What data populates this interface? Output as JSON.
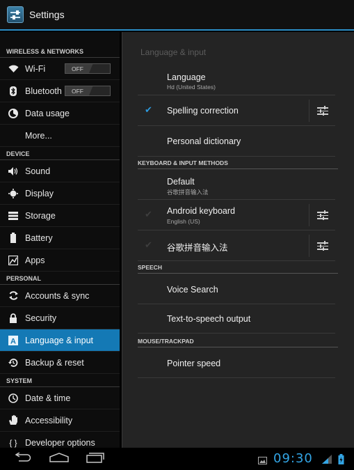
{
  "actionbar": {
    "title": "Settings",
    "icon": "settings-app-icon"
  },
  "left": {
    "sections": {
      "wireless": "WIRELESS & NETWORKS",
      "device": "DEVICE",
      "personal": "PERSONAL",
      "system": "SYSTEM"
    },
    "wifi": {
      "label": "Wi-Fi",
      "toggle": "OFF",
      "icon": "wifi-icon"
    },
    "bluetooth": {
      "label": "Bluetooth",
      "toggle": "OFF",
      "icon": "bluetooth-icon"
    },
    "data_usage": {
      "label": "Data usage",
      "icon": "data-usage-icon"
    },
    "more": {
      "label": "More..."
    },
    "sound": {
      "label": "Sound",
      "icon": "speaker-icon"
    },
    "display": {
      "label": "Display",
      "icon": "display-icon"
    },
    "storage": {
      "label": "Storage",
      "icon": "storage-icon"
    },
    "battery": {
      "label": "Battery",
      "icon": "battery-icon"
    },
    "apps": {
      "label": "Apps",
      "icon": "apps-icon"
    },
    "accounts": {
      "label": "Accounts & sync",
      "icon": "sync-icon"
    },
    "security": {
      "label": "Security",
      "icon": "lock-icon"
    },
    "language": {
      "label": "Language & input",
      "icon": "language-icon"
    },
    "backup": {
      "label": "Backup & reset",
      "icon": "backup-icon"
    },
    "datetime": {
      "label": "Date & time",
      "icon": "clock-icon"
    },
    "accessibility": {
      "label": "Accessibility",
      "icon": "hand-icon"
    },
    "developer": {
      "label": "Developer options",
      "icon": "braces-icon"
    }
  },
  "right": {
    "title": "Language & input",
    "language": {
      "label": "Language",
      "value": "Hd (United States)"
    },
    "spelling": {
      "label": "Spelling correction",
      "checked": true
    },
    "dictionary": {
      "label": "Personal dictionary"
    },
    "keyboard_section": "KEYBOARD & INPUT METHODS",
    "default": {
      "label": "Default",
      "value": "谷歌拼音输入法"
    },
    "android_keyboard": {
      "label": "Android keyboard",
      "value": "English (US)",
      "checked": true
    },
    "pinyin": {
      "label": "谷歌拼音输入法",
      "checked": true
    },
    "speech_section": "SPEECH",
    "voice_search": {
      "label": "Voice Search"
    },
    "tts": {
      "label": "Text-to-speech output"
    },
    "mouse_section": "MOUSE/TRACKPAD",
    "pointer": {
      "label": "Pointer speed"
    }
  },
  "statusbar": {
    "time": "09:30"
  },
  "colors": {
    "accent": "#33a5e5",
    "selected": "#1479b5"
  }
}
